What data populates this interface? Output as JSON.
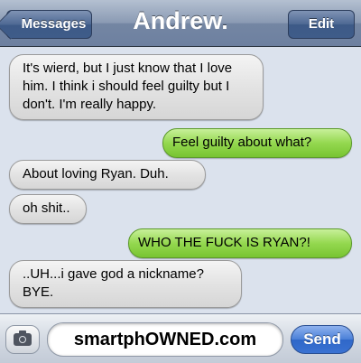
{
  "navbar": {
    "back_label": "Messages",
    "title": "Andrew.",
    "edit_label": "Edit"
  },
  "messages": [
    {
      "direction": "incoming",
      "text": "It's wierd, but I just know that I love him. I think i should feel guilty but I don't. I'm really happy."
    },
    {
      "direction": "outgoing",
      "text": "Feel guilty about what?"
    },
    {
      "direction": "incoming",
      "text": "About loving Ryan. Duh."
    },
    {
      "direction": "incoming",
      "text": "oh shit.."
    },
    {
      "direction": "outgoing",
      "text": "WHO THE FUCK IS RYAN?!"
    },
    {
      "direction": "incoming",
      "text": "..UH...i gave god a nickname? BYE."
    }
  ],
  "input_bar": {
    "text_value": "smartphOWNED.com",
    "send_label": "Send"
  },
  "colors": {
    "incoming_bubble": "#e3e3e3",
    "outgoing_bubble": "#94d84f",
    "navbar": "#8a9ab3",
    "send_button": "#3a72d2"
  }
}
